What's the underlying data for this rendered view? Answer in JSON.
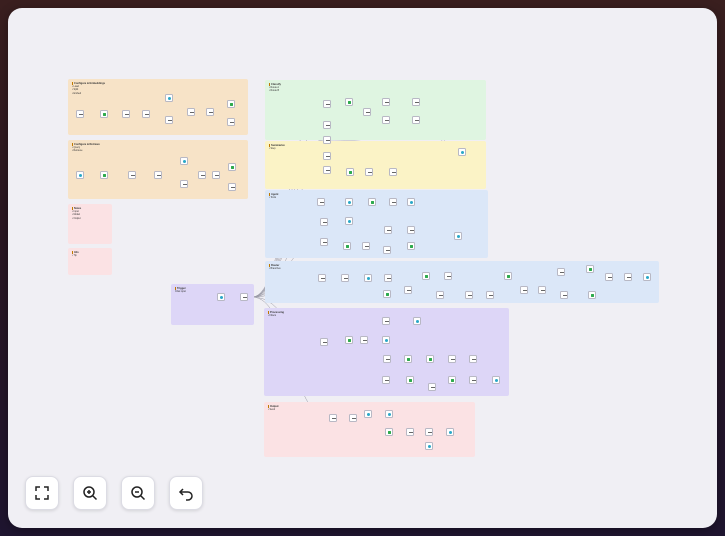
{
  "canvas": {
    "notes": [
      {
        "id": "n1",
        "title": "Configure & Embeddings",
        "lines": [
          "• Load",
          "• Split",
          "• Embed"
        ],
        "color": "#f7e3c7"
      },
      {
        "id": "n2",
        "title": "Configure & Retrieve",
        "lines": [
          "• Query",
          "• Retrieve"
        ],
        "color": "#f7e3c7"
      },
      {
        "id": "n3",
        "title": "Notes",
        "lines": [
          "• Input",
          "• Model",
          "• Output"
        ],
        "color": "#fbe2e4"
      },
      {
        "id": "n4",
        "title": "Info",
        "lines": [
          "• Tip"
        ],
        "color": "#fbe2e4"
      },
      {
        "id": "n5",
        "title": "Trigger",
        "lines": [
          "Chat input"
        ],
        "color": "#ddd6f7"
      },
      {
        "id": "n6",
        "title": "Classify",
        "lines": [
          "• Route A",
          "• Route B"
        ],
        "color": "#dff5e1"
      },
      {
        "id": "n7",
        "title": "Summarize",
        "lines": [
          "• Step"
        ],
        "color": "#fbf3c6"
      },
      {
        "id": "n8",
        "title": "Agent",
        "lines": [
          "• Tools"
        ],
        "color": "#dbe7f8"
      },
      {
        "id": "n9",
        "title": "Router",
        "lines": [
          "• Branches"
        ],
        "color": "#dbe7f8"
      },
      {
        "id": "n10",
        "title": "Processing",
        "lines": [
          "• Filters"
        ],
        "color": "#ddd6f7"
      },
      {
        "id": "n11",
        "title": "Output",
        "lines": [
          "• Send"
        ],
        "color": "#fbe2e4"
      }
    ]
  },
  "controls": {
    "fit": "fit-view",
    "zoom_in": "zoom-in",
    "zoom_out": "zoom-out",
    "reset": "reset"
  }
}
